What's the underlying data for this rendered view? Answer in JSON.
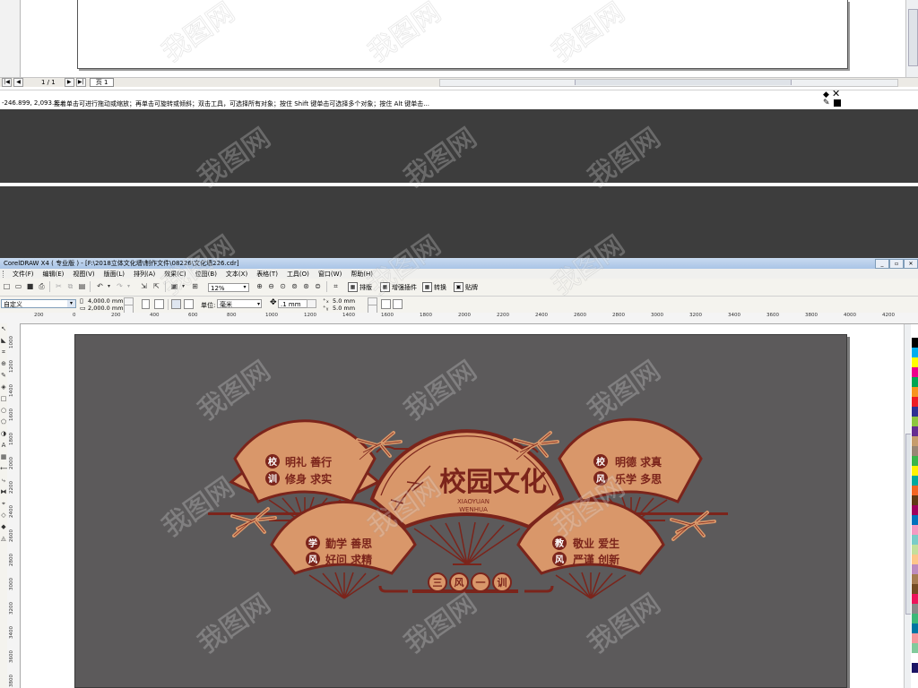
{
  "status_bar": {
    "coordinates": "-246.899, 2,093.3...",
    "hint": "接着单击可进行拖动或缩放；再单击可旋转或倾斜；双击工具，可选择所有对象；按住 Shift 键单击可选择多个对象；按住 Alt 键单击..."
  },
  "page_navigator": {
    "first": "|◀",
    "prev": "◀",
    "page_count": "1 / 1",
    "next": "▶",
    "last": "▶|",
    "page_tab": "页 1"
  },
  "window": {
    "title": "CorelDRAW X4 ( 专业版 ) - [F:\\2018立体文化墙\\制作文件\\08226\\文化墙226.cdr]",
    "minimize": "_",
    "restore": "▫",
    "close": "✕"
  },
  "menu": [
    "文件(F)",
    "编辑(E)",
    "视图(V)",
    "版面(L)",
    "排列(A)",
    "效果(C)",
    "位图(B)",
    "文本(X)",
    "表格(T)",
    "工具(O)",
    "窗口(W)",
    "帮助(H)"
  ],
  "toolbar": {
    "zoom": "12%",
    "arrange_label": "排版",
    "plugin_label": "增强插件",
    "convert_label": "转换",
    "paste_label": "贴牌"
  },
  "property_bar": {
    "page_size": "自定义",
    "width": "4,000.0 mm",
    "height": "2,000.0 mm",
    "unit_label": "单位:",
    "unit": "毫米",
    "nudge": ".1 mm",
    "dup_x": "5.0 mm",
    "dup_y": "5.0 mm"
  },
  "ruler": {
    "h_labels": [
      "200",
      "0",
      "200",
      "400",
      "600",
      "800",
      "1000",
      "1200",
      "1400",
      "1600",
      "1800",
      "2000",
      "2200",
      "2400",
      "2600",
      "2800",
      "3000",
      "3200",
      "3400",
      "3600",
      "3800",
      "4000",
      "4200"
    ],
    "v_labels": [
      "1000",
      "1200",
      "1400",
      "1600",
      "1800",
      "2000",
      "2200",
      "2400",
      "2600",
      "2800",
      "3000",
      "3200",
      "3400",
      "3600",
      "3800"
    ]
  },
  "artwork": {
    "main": {
      "title": "校园文化",
      "subtitle_line1": "XIAOYUAN",
      "subtitle_line2": "WENHUA"
    },
    "fan_top_left": {
      "badge1": "校",
      "badge2": "训",
      "line1": "明礼 善行",
      "line2": "修身 求实"
    },
    "fan_top_right": {
      "badge1": "校",
      "badge2": "风",
      "line1": "明德 求真",
      "line2": "乐学 多思"
    },
    "fan_bottom_left": {
      "badge1": "学",
      "badge2": "风",
      "line1": "勤学 善思",
      "line2": "好问 求精"
    },
    "fan_bottom_right": {
      "badge1": "教",
      "badge2": "风",
      "line1": "敬业 爱生",
      "line2": "严谨 创新"
    },
    "bottom_badges": [
      "三",
      "风",
      "一",
      "训"
    ],
    "colors": {
      "fan": "#d9976a",
      "dark": "#7b241b",
      "page": "#5c5a5b"
    }
  },
  "palette_colors": [
    "#ffffff",
    "#000000",
    "#00aeef",
    "#ffff00",
    "#ec008c",
    "#00a651",
    "#f7941d",
    "#ed1c24",
    "#2e3192",
    "#8dc63f",
    "#662d91",
    "#c69c6d",
    "#998675",
    "#39b54a",
    "#fff200",
    "#00a99d",
    "#f26522",
    "#603913",
    "#9e005d",
    "#0072bc",
    "#f49ac2",
    "#7accc8",
    "#c4df9b",
    "#fdc689",
    "#bd8cbf",
    "#a67c52",
    "#754c24",
    "#ed145b",
    "#898989",
    "#3cb878",
    "#0076a3",
    "#f5989d",
    "#82ca9c",
    "#ffffff",
    "#1b1464"
  ],
  "watermark": "我图网"
}
